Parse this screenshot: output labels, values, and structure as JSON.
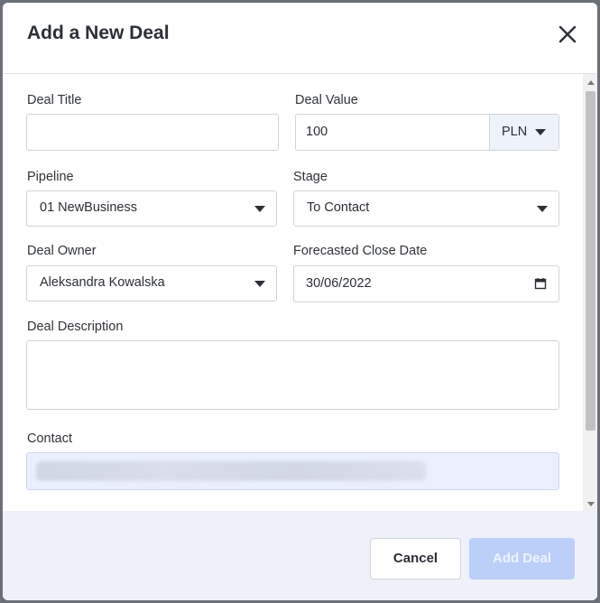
{
  "modal": {
    "title": "Add a New Deal"
  },
  "form": {
    "deal_title": {
      "label": "Deal Title",
      "value": ""
    },
    "deal_value": {
      "label": "Deal Value",
      "value": "100",
      "currency": "PLN"
    },
    "pipeline": {
      "label": "Pipeline",
      "value": "01 NewBusiness"
    },
    "stage": {
      "label": "Stage",
      "value": "To Contact"
    },
    "deal_owner": {
      "label": "Deal Owner",
      "value": "Aleksandra Kowalska"
    },
    "close_date": {
      "label": "Forecasted Close Date",
      "value": "30/06/2022"
    },
    "description": {
      "label": "Deal Description",
      "value": ""
    },
    "contact": {
      "label": "Contact",
      "value": ""
    }
  },
  "footer": {
    "cancel_label": "Cancel",
    "add_label": "Add Deal"
  },
  "colors": {
    "primary_disabled": "#bccff8",
    "footer_bg": "#eef1f9",
    "text": "#2b2f36"
  },
  "icons": {
    "close": "close-icon",
    "dropdown": "chevron-down-icon",
    "calendar": "calendar-icon"
  }
}
